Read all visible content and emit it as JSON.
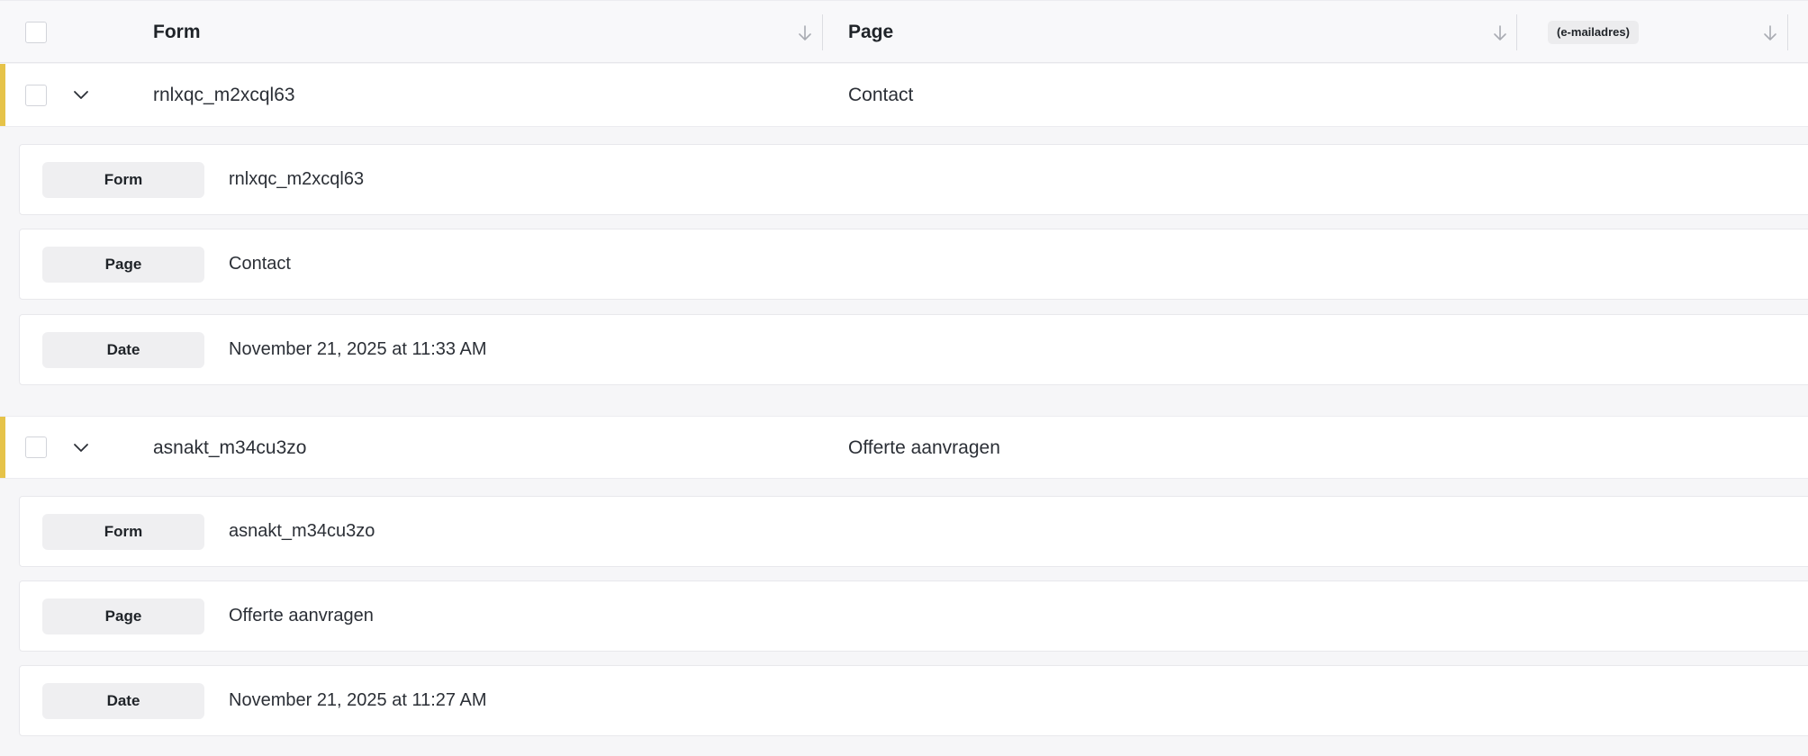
{
  "header": {
    "columns": [
      {
        "label": "Form"
      },
      {
        "label": "Page"
      },
      {
        "label": "(e-mailadres)"
      }
    ]
  },
  "entries": [
    {
      "form": "rnlxqc_m2xcql63",
      "page": "Contact",
      "details": [
        {
          "label": "Form",
          "value": "rnlxqc_m2xcql63"
        },
        {
          "label": "Page",
          "value": "Contact"
        },
        {
          "label": "Date",
          "value": "November 21, 2025 at 11:33 AM"
        }
      ]
    },
    {
      "form": "asnakt_m34cu3zo",
      "page": "Offerte aanvragen",
      "details": [
        {
          "label": "Form",
          "value": "asnakt_m34cu3zo"
        },
        {
          "label": "Page",
          "value": "Offerte aanvragen"
        },
        {
          "label": "Date",
          "value": "November 21, 2025 at 11:27 AM"
        }
      ]
    }
  ],
  "colors": {
    "accent": "#e6c349",
    "background": "#f6f6f8",
    "label_bg": "#efeff1"
  },
  "icons": {
    "sort": "arrow-down-icon",
    "expand": "chevron-down-icon"
  }
}
